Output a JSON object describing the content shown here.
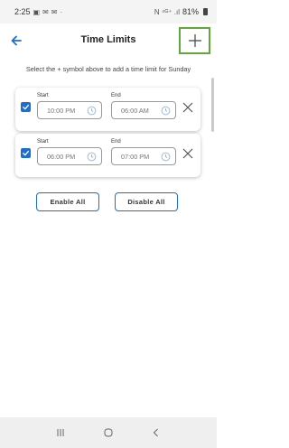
{
  "status_bar": {
    "time": "2:25",
    "left_icons": [
      "gallery-icon",
      "message-icon",
      "message-icon",
      "dot-icon"
    ],
    "signal_text": "N ⁴ᴳ⁺ .ıl",
    "battery": "81%"
  },
  "header": {
    "title": "Time Limits",
    "back_icon": "arrow-left-icon",
    "add_icon": "plus-icon"
  },
  "instruction": "Select the + symbol above to add a time limit for Sunday",
  "time_limits": [
    {
      "checked": true,
      "start_label": "Start",
      "start_value": "10:00 PM",
      "end_label": "End",
      "end_value": "06:00 AM"
    },
    {
      "checked": true,
      "start_label": "Start",
      "start_value": "06:00 PM",
      "end_label": "End",
      "end_value": "07:00 PM"
    }
  ],
  "actions": {
    "enable_all": "Enable All",
    "disable_all": "Disable All"
  },
  "colors": {
    "accent": "#1a6fd0",
    "highlight": "#5fa83a"
  },
  "nav_bar": [
    "recent-apps-icon",
    "home-icon",
    "back-icon"
  ]
}
